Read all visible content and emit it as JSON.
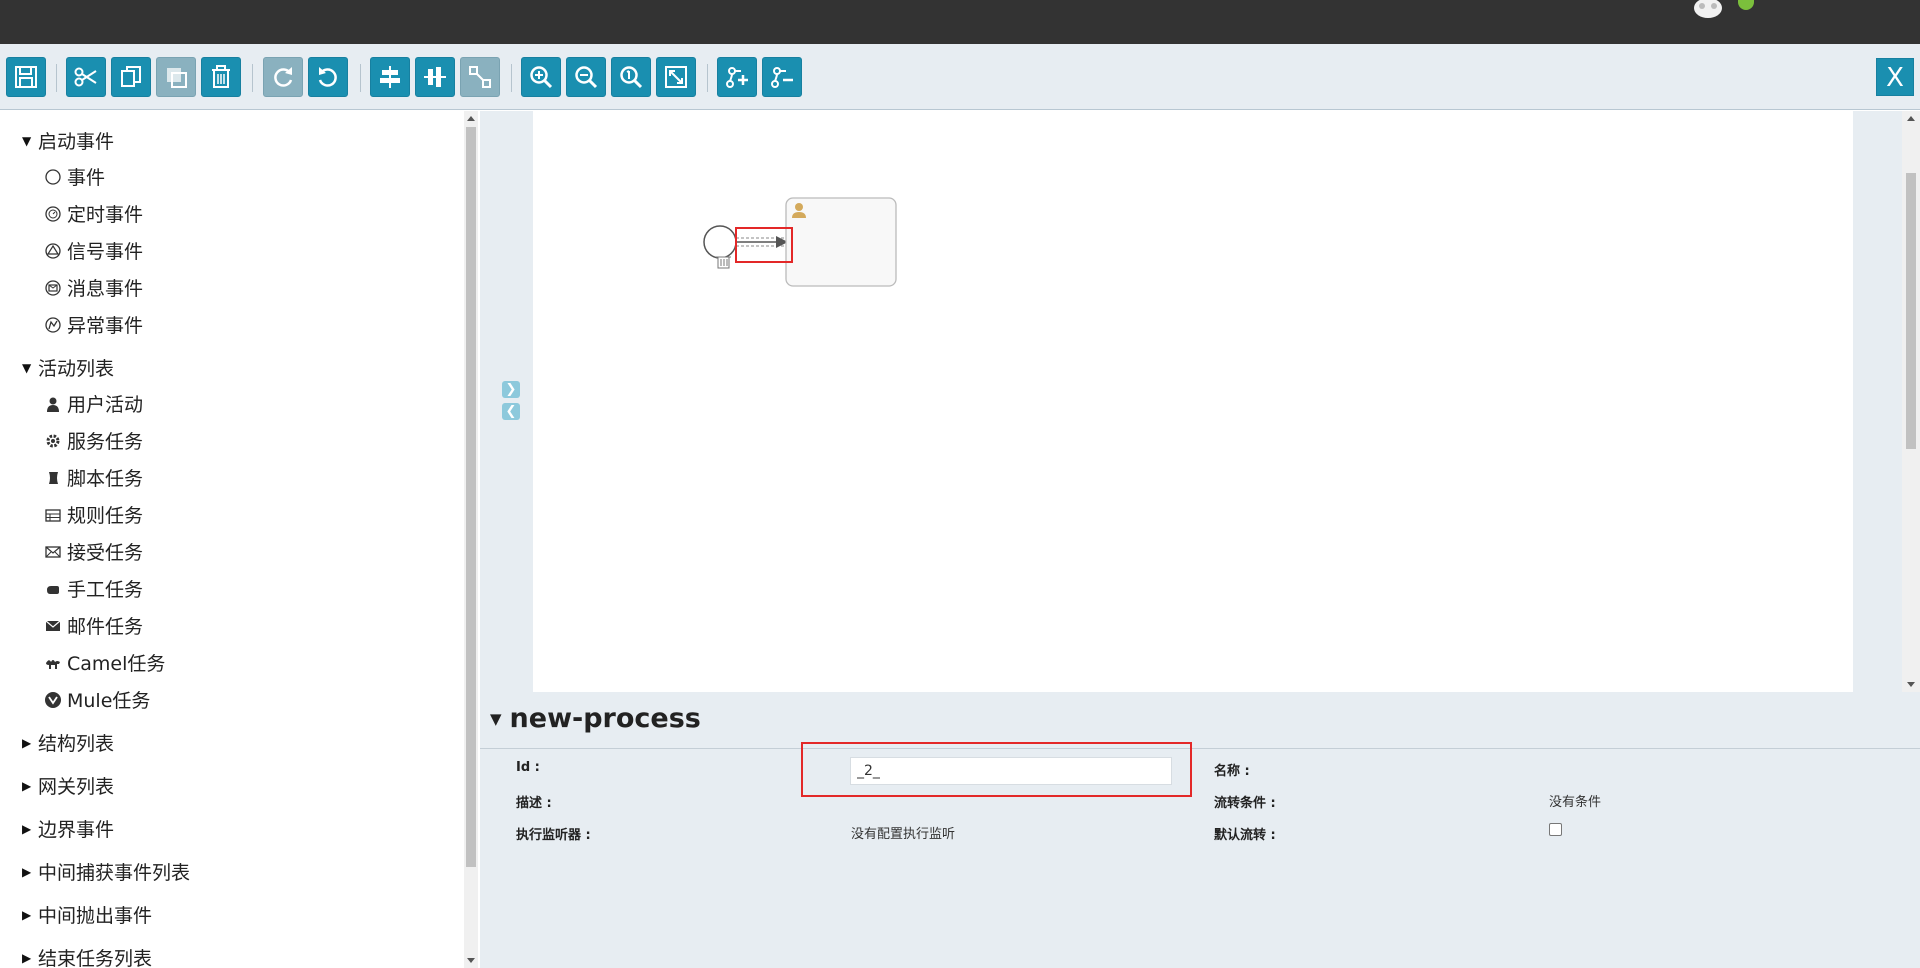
{
  "toolbar": {
    "buttons": [
      {
        "name": "save",
        "icon": "save-icon"
      },
      {
        "name": "cut",
        "icon": "scissors-icon"
      },
      {
        "name": "copy",
        "icon": "copy-icon"
      },
      {
        "name": "paste",
        "icon": "paste-icon",
        "disabled": true
      },
      {
        "name": "delete",
        "icon": "trash-icon"
      },
      {
        "name": "redo",
        "icon": "redo-icon",
        "disabled": true
      },
      {
        "name": "undo",
        "icon": "undo-icon"
      },
      {
        "name": "align-horizontal",
        "icon": "align-horizontal-icon"
      },
      {
        "name": "align-vertical",
        "icon": "align-vertical-icon"
      },
      {
        "name": "same-size",
        "icon": "same-size-icon",
        "disabled": true
      },
      {
        "name": "zoom-in",
        "icon": "zoom-in-icon"
      },
      {
        "name": "zoom-out",
        "icon": "zoom-out-icon"
      },
      {
        "name": "zoom-actual",
        "icon": "zoom-actual-icon"
      },
      {
        "name": "zoom-fit",
        "icon": "zoom-fit-icon"
      },
      {
        "name": "add-bendpoint",
        "icon": "add-bendpoint-icon"
      },
      {
        "name": "remove-bendpoint",
        "icon": "remove-bendpoint-icon"
      }
    ],
    "close_label": "X"
  },
  "palette": {
    "groups": [
      {
        "label": "启动事件",
        "expanded": true,
        "items": [
          "事件",
          "定时事件",
          "信号事件",
          "消息事件",
          "异常事件"
        ]
      },
      {
        "label": "活动列表",
        "expanded": true,
        "items": [
          "用户活动",
          "服务任务",
          "脚本任务",
          "规则任务",
          "接受任务",
          "手工任务",
          "邮件任务",
          "Camel任务",
          "Mule任务"
        ]
      },
      {
        "label": "结构列表",
        "expanded": false
      },
      {
        "label": "网关列表",
        "expanded": false
      },
      {
        "label": "边界事件",
        "expanded": false
      },
      {
        "label": "中间捕获事件列表",
        "expanded": false
      },
      {
        "label": "中间抛出事件",
        "expanded": false
      },
      {
        "label": "结束任务列表",
        "expanded": false
      }
    ]
  },
  "canvas": {
    "collapse_right": "❯",
    "collapse_left": "❮"
  },
  "properties": {
    "title": "new-process",
    "id_label": "Id :",
    "id_value": "_2_",
    "name_label": "名称 :",
    "desc_label": "描述 :",
    "condition_label": "流转条件 :",
    "condition_value": "没有条件",
    "listener_label": "执行监听器 :",
    "listener_value": "没有配置执行监听",
    "default_flow_label": "默认流转 :",
    "default_flow_checked": false
  },
  "colors": {
    "accent": "#1a8fb0",
    "highlight": "#e32828",
    "topbar": "#333333",
    "panel": "#e7edf2"
  }
}
